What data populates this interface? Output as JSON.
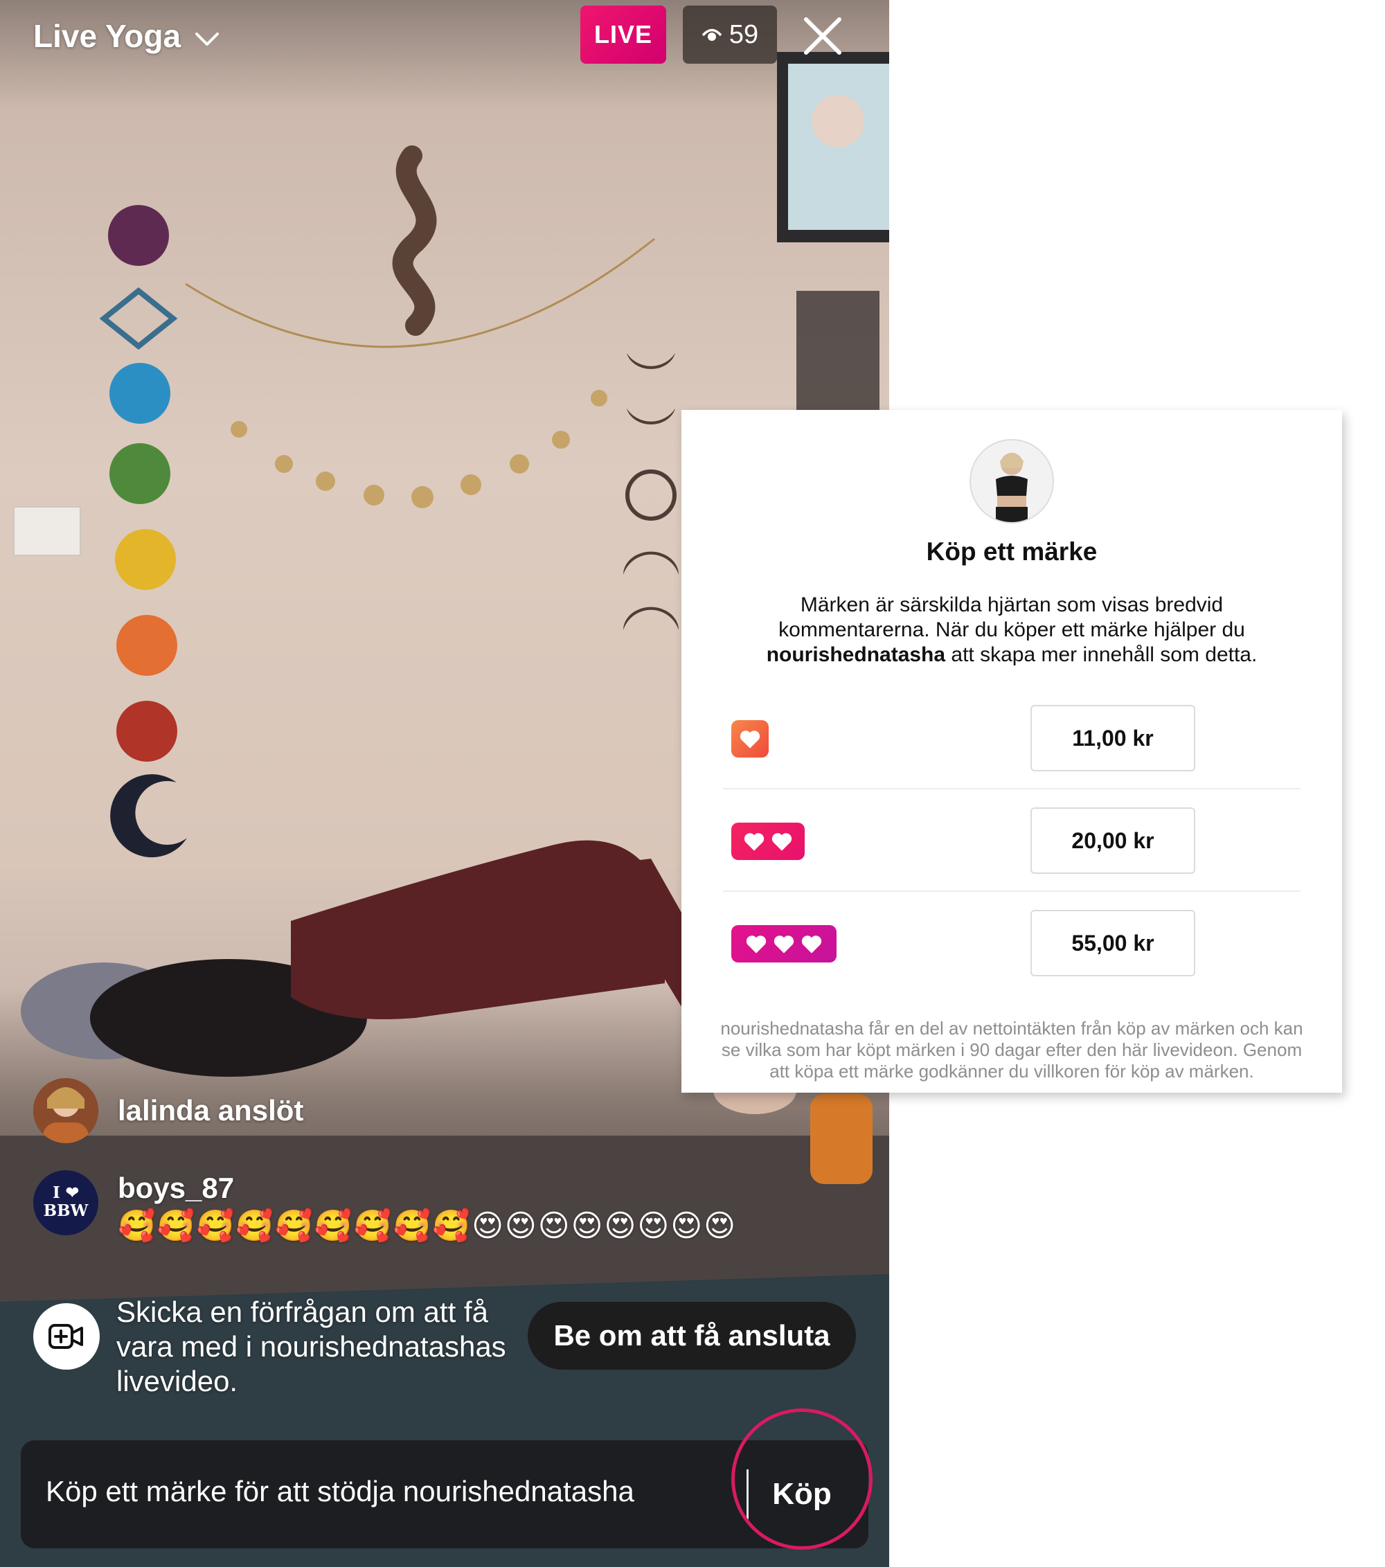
{
  "live_view": {
    "title": "Live Yoga",
    "title_icon": "chevron-down-icon",
    "live_label": "LIVE",
    "viewer_count": "59",
    "viewer_icon": "eye-icon",
    "close_icon": "close-icon",
    "accent_color": "#e8126e"
  },
  "comments": [
    {
      "user": "lalinda",
      "text": "lalinda anslöt"
    },
    {
      "user": "boys_87",
      "avatar_text": "I ❤ BBW",
      "text": "🥰🥰🥰🥰🥰🥰🥰🥰🥰😍😍😍😍😍😍😍😍"
    }
  ],
  "cohost": {
    "icon": "video-plus-icon",
    "text": "Skicka en förfrågan om att få vara med i nourishednatashas livevideo.",
    "button_label": "Be om att få ansluta"
  },
  "buy_bar": {
    "placeholder": "Köp ett märke för att stödja nourishednatasha",
    "button_label": "Köp"
  },
  "badge_sheet": {
    "title": "Köp ett märke",
    "description_before": "Märken är särskilda hjärtan som visas bredvid kommentarerna. När du köper ett märke hjälper du ",
    "description_user": "nourishednatasha",
    "description_after": " att skapa mer innehåll som detta.",
    "tiers": [
      {
        "hearts": 1,
        "price": "11,00 kr",
        "color": "#f26a3d"
      },
      {
        "hearts": 2,
        "price": "20,00 kr",
        "color": "#f0145a"
      },
      {
        "hearts": 3,
        "price": "55,00 kr",
        "color": "#d6128f"
      }
    ],
    "footer": "nourishednatasha får en del av nettointäkten från köp av märken och kan se vilka som har köpt märken i 90 dagar efter den här livevideon. Genom att köpa ett märke godkänner du villkoren för köp av märken."
  }
}
